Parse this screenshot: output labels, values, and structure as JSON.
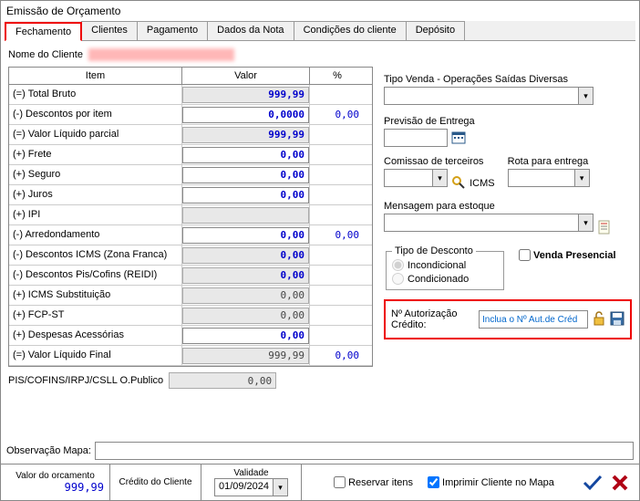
{
  "window_title": "Emissão de Orçamento",
  "tabs": [
    "Fechamento",
    "Clientes",
    "Pagamento",
    "Dados da Nota",
    "Condições do cliente",
    "Depósito"
  ],
  "active_tab": 0,
  "client_label": "Nome do Cliente",
  "grid": {
    "headers": {
      "item": "Item",
      "valor": "Valor",
      "pct": "%"
    },
    "rows": [
      {
        "label": "(=) Total Bruto",
        "valor": "999,99",
        "gray": true,
        "blue": true,
        "pct": ""
      },
      {
        "label": "(-) Descontos por item",
        "valor": "0,0000",
        "gray": false,
        "blue": true,
        "pct": "0,00"
      },
      {
        "label": "(=) Valor Líquido parcial",
        "valor": "999,99",
        "gray": true,
        "blue": true,
        "pct": ""
      },
      {
        "label": "(+) Frete",
        "valor": "0,00",
        "gray": false,
        "blue": true,
        "pct": ""
      },
      {
        "label": "(+) Seguro",
        "valor": "0,00",
        "gray": false,
        "blue": true,
        "pct": ""
      },
      {
        "label": "(+) Juros",
        "valor": "0,00",
        "gray": false,
        "blue": true,
        "pct": ""
      },
      {
        "label": "(+) IPI",
        "valor": "",
        "gray": true,
        "blue": false,
        "pct": ""
      },
      {
        "label": "(-) Arredondamento",
        "valor": "0,00",
        "gray": false,
        "blue": true,
        "pct": "0,00"
      },
      {
        "label": "(-) Descontos ICMS (Zona Franca)",
        "valor": "0,00",
        "gray": true,
        "blue": true,
        "pct": ""
      },
      {
        "label": "(-) Descontos Pis/Cofins (REIDI)",
        "valor": "0,00",
        "gray": true,
        "blue": true,
        "pct": ""
      },
      {
        "label": "(+) ICMS Substituição",
        "valor": "0,00",
        "gray": true,
        "blue": false,
        "pct": ""
      },
      {
        "label": "(+) FCP-ST",
        "valor": "0,00",
        "gray": true,
        "blue": false,
        "pct": ""
      },
      {
        "label": "(+) Despesas Acessórias",
        "valor": "0,00",
        "gray": false,
        "blue": true,
        "pct": ""
      },
      {
        "label": "(=) Valor Líquido Final",
        "valor": "999,99",
        "gray": true,
        "blue": false,
        "pct": "0,00"
      }
    ]
  },
  "pis_label": "PIS/COFINS/IRPJ/CSLL O.Publico",
  "pis_value": "0,00",
  "right": {
    "tipo_venda_label": "Tipo Venda - Operações Saídas Diversas",
    "previsao_label": "Previsão de Entrega",
    "comissao_label": "Comissao de terceiros",
    "icms_label": "ICMS",
    "rota_label": "Rota para entrega",
    "mensagem_label": "Mensagem para estoque",
    "tipo_desconto_label": "Tipo de Desconto",
    "radio_incondicional": "Incondicional",
    "radio_condicionado": "Condicionado",
    "venda_presencial_label": "Venda Presencial",
    "auth_label": "Nº Autorização Crédito:",
    "auth_placeholder": "Inclua o Nº Aut.de Créd"
  },
  "observ_label": "Observação Mapa:",
  "footer": {
    "valor_orc_label": "Valor do orcamento",
    "valor_orc": "999,99",
    "credito_label": "Crédito do Cliente",
    "validade_label": "Validade",
    "validade_value": "01/09/2024",
    "reservar_label": "Reservar itens",
    "imprimir_label": "Imprimir Cliente no Mapa"
  }
}
